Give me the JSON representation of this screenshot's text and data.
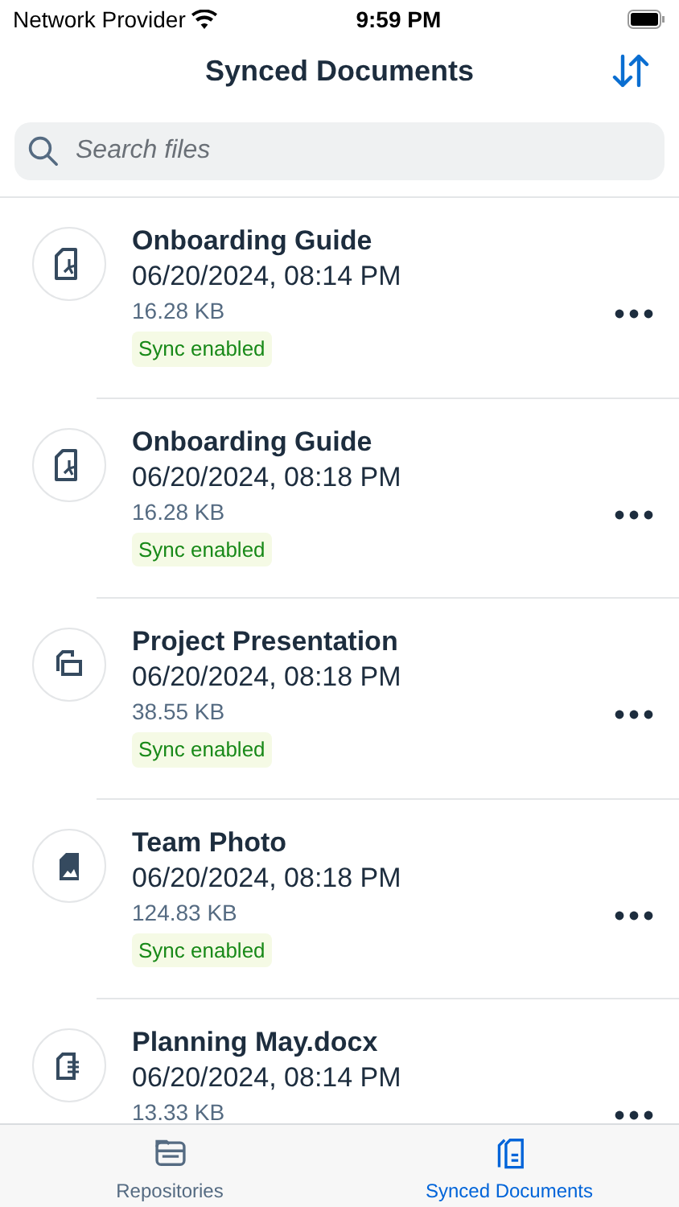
{
  "status_bar": {
    "carrier": "Network Provider",
    "time": "9:59 PM"
  },
  "nav": {
    "title": "Synced Documents"
  },
  "search": {
    "placeholder": "Search files"
  },
  "files": [
    {
      "kind": "pdf",
      "name": "Onboarding Guide",
      "date": "06/20/2024, 08:14 PM",
      "size": "16.28 KB",
      "tag": "Sync enabled"
    },
    {
      "kind": "pdf",
      "name": "Onboarding Guide",
      "date": "06/20/2024, 08:18 PM",
      "size": "16.28 KB",
      "tag": "Sync enabled"
    },
    {
      "kind": "presentation",
      "name": "Project Presentation",
      "date": "06/20/2024, 08:18 PM",
      "size": "38.55 KB",
      "tag": "Sync enabled"
    },
    {
      "kind": "image",
      "name": "Team Photo",
      "date": "06/20/2024, 08:18 PM",
      "size": "124.83 KB",
      "tag": "Sync enabled"
    },
    {
      "kind": "doc",
      "name": "Planning May.docx",
      "date": "06/20/2024, 08:14 PM",
      "size": "13.33 KB"
    }
  ],
  "tab_bar": [
    {
      "kind": "folder",
      "label": "Repositories",
      "selected": false
    },
    {
      "kind": "docs",
      "label": "Synced Documents",
      "selected": true
    }
  ]
}
